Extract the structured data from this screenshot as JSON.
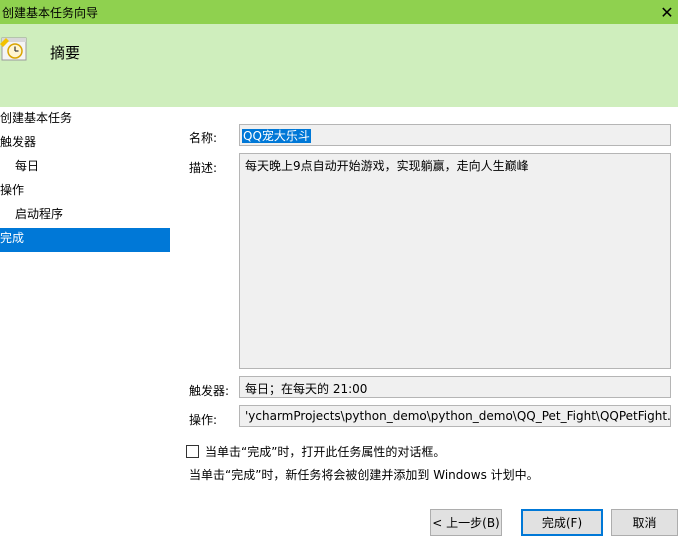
{
  "window": {
    "title": "创建基本任务向导"
  },
  "header": {
    "heading": "摘要",
    "icon": "clock-task-icon"
  },
  "sidebar": {
    "items": [
      {
        "label": "创建基本任务"
      },
      {
        "label": "触发器"
      },
      {
        "label": "每日"
      },
      {
        "label": "操作"
      },
      {
        "label": "启动程序"
      },
      {
        "label": "完成"
      }
    ],
    "selected": "完成"
  },
  "form": {
    "name_label": "名称:",
    "name_value": "QQ宠大乐斗",
    "desc_label": "描述:",
    "desc_value": "每天晚上9点自动开始游戏，实现躺赢，走向人生巅峰",
    "trigger_label": "触发器:",
    "trigger_value": "每日；在每天的 21:00",
    "action_label": "操作:",
    "action_value": "'ycharmProjects\\python_demo\\python_demo\\QQ_Pet_Fight\\QQPetFight.py"
  },
  "options": {
    "open_props_label": "当单击“完成”时，打开此任务属性的对话框。",
    "open_props_checked": false,
    "note": "当单击“完成”时，新任务将会被创建并添加到 Windows 计划中。"
  },
  "buttons": {
    "back": "< 上一步(B)",
    "finish": "完成(F)",
    "cancel": "取消"
  },
  "colors": {
    "titlebar": "#8fd14f",
    "header": "#cfeebd",
    "selection": "#0078d7"
  }
}
